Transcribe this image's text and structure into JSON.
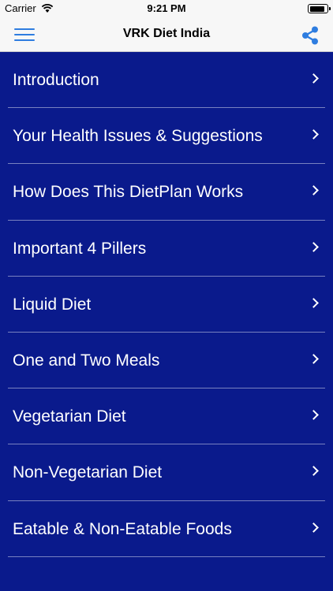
{
  "status_bar": {
    "carrier": "Carrier",
    "time": "9:21 PM",
    "battery_level": 0.9
  },
  "nav": {
    "title": "VRK Diet India",
    "menu_icon": "hamburger-menu-icon",
    "share_icon": "share-icon"
  },
  "menu": {
    "items": [
      {
        "label": "Introduction"
      },
      {
        "label": "Your Health Issues & Suggestions"
      },
      {
        "label": "How Does This DietPlan Works"
      },
      {
        "label": "Important 4 Pillers"
      },
      {
        "label": "Liquid Diet"
      },
      {
        "label": "One and Two Meals"
      },
      {
        "label": "Vegetarian Diet"
      },
      {
        "label": "Non-Vegetarian Diet"
      },
      {
        "label": "Eatable & Non-Eatable Foods"
      }
    ]
  },
  "colors": {
    "list_background": "#0a1a8c",
    "accent": "#2e7de0",
    "bar_background": "#f7f7f7"
  }
}
